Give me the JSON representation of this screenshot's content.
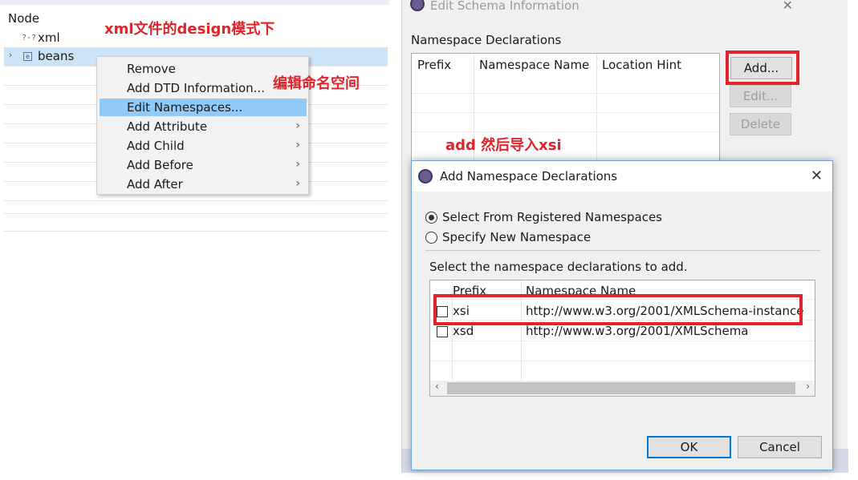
{
  "left_tree": {
    "header": "Node",
    "rows": [
      {
        "icon": "?-?",
        "label": "xml"
      },
      {
        "icon": "e",
        "label": "beans"
      }
    ]
  },
  "context_menu": {
    "items": [
      {
        "label": "Remove",
        "has_submenu": false
      },
      {
        "label": "Add DTD Information...",
        "has_submenu": false
      },
      {
        "label": "Edit Namespaces...",
        "has_submenu": false,
        "highlighted": true
      },
      {
        "label": "Add Attribute",
        "has_submenu": true
      },
      {
        "label": "Add Child",
        "has_submenu": true
      },
      {
        "label": "Add Before",
        "has_submenu": true
      },
      {
        "label": "Add After",
        "has_submenu": true
      }
    ],
    "arrow": "›"
  },
  "annotations": {
    "top": "xml文件的design模式下",
    "menu": "编辑命名空间",
    "add": "add  然后导入xsi"
  },
  "schema_dialog": {
    "title": "Edit Schema Information",
    "close": "✕",
    "section": "Namespace Declarations",
    "columns": [
      "Prefix",
      "Namespace Name",
      "Location Hint"
    ],
    "buttons": {
      "add": "Add...",
      "edit": "Edit...",
      "delete": "Delete"
    }
  },
  "add_dialog": {
    "title": "Add Namespace Declarations",
    "close": "✕",
    "radio_registered": "Select From Registered Namespaces",
    "radio_new": "Specify New Namespace",
    "instruction": "Select the namespace declarations to add.",
    "columns": [
      "Prefix",
      "Namespace Name"
    ],
    "rows": [
      {
        "prefix": "xsi",
        "namespace": "http://www.w3.org/2001/XMLSchema-instance",
        "checked": false
      },
      {
        "prefix": "xsd",
        "namespace": "http://www.w3.org/2001/XMLSchema",
        "checked": false
      }
    ],
    "scroll_left": "‹",
    "scroll_right": "›",
    "ok": "OK",
    "cancel": "Cancel"
  },
  "colors": {
    "annotation": "#e0242a",
    "highlight": "#91c9f7",
    "selection": "#cce4f7"
  }
}
